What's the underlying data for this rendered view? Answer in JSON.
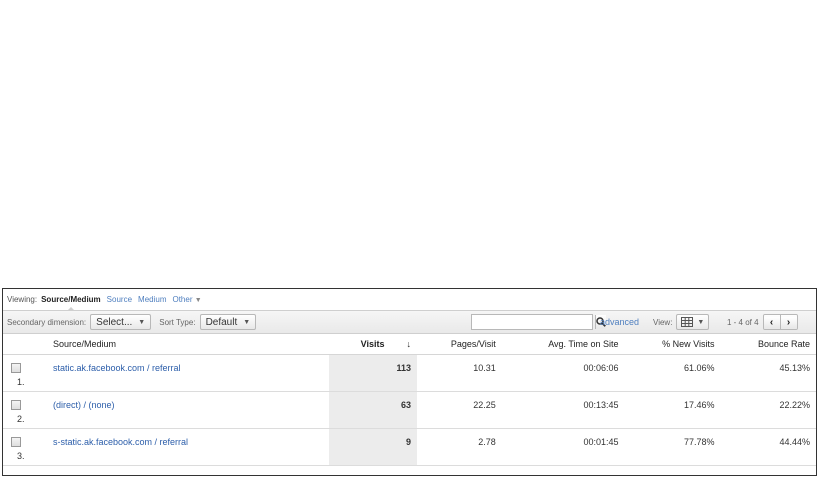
{
  "viewing": {
    "label": "Viewing:",
    "active": "Source/Medium",
    "options": [
      "Source",
      "Medium"
    ],
    "other": "Other"
  },
  "toolbar": {
    "secondary_label": "Secondary dimension:",
    "secondary_value": "Select...",
    "sort_label": "Sort Type:",
    "sort_value": "Default",
    "advanced": "advanced",
    "view_label": "View:",
    "range": "1 - 4 of 4"
  },
  "table": {
    "headers": {
      "source": "Source/Medium",
      "visits": "Visits",
      "pages": "Pages/Visit",
      "time": "Avg. Time on Site",
      "new": "% New Visits",
      "bounce": "Bounce Rate"
    },
    "rows": [
      {
        "num": "1.",
        "source": "static.ak.facebook.com / referral",
        "visits": "113",
        "pages": "10.31",
        "time": "00:06:06",
        "new": "61.06%",
        "bounce": "45.13%"
      },
      {
        "num": "2.",
        "source": "(direct) / (none)",
        "visits": "63",
        "pages": "22.25",
        "time": "00:13:45",
        "new": "17.46%",
        "bounce": "22.22%"
      },
      {
        "num": "3.",
        "source": "s-static.ak.facebook.com / referral",
        "visits": "9",
        "pages": "2.78",
        "time": "00:01:45",
        "new": "77.78%",
        "bounce": "44.44%"
      }
    ]
  }
}
